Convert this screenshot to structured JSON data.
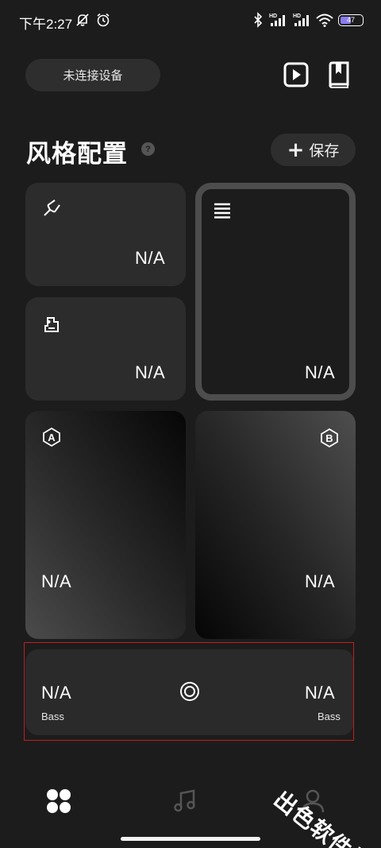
{
  "status_bar": {
    "time": "下午2:27",
    "battery_level": "47",
    "battery_color": "#8a7cf0",
    "icons": [
      "mute-notification-icon",
      "alarm-icon",
      "bluetooth-icon",
      "hd-signal-icon",
      "hd-signal-icon",
      "wifi-icon",
      "battery-icon"
    ]
  },
  "header": {
    "device_status": "未连接设备",
    "play_icon": "play-icon",
    "book_icon": "bookmark-icon"
  },
  "page": {
    "title": "风格配置",
    "help_icon": "help-icon",
    "save_label": "保存"
  },
  "cards": {
    "tuning": {
      "icon": "tuning-fork-icon",
      "value": "N/A"
    },
    "eq": {
      "icon": "equalizer-icon",
      "value": "N/A"
    },
    "list": {
      "icon": "list-icon",
      "value": "N/A"
    },
    "preset_a": {
      "icon": "badge-a-icon",
      "value": "N/A"
    },
    "preset_b": {
      "icon": "badge-b-icon",
      "value": "N/A"
    },
    "bass": {
      "left_value": "N/A",
      "left_label": "Bass",
      "right_value": "N/A",
      "right_label": "Bass",
      "center_icon": "target-icon"
    }
  },
  "bottom_nav": {
    "items": [
      {
        "icon": "grid-icon",
        "active": true
      },
      {
        "icon": "music-note-icon",
        "active": false
      },
      {
        "icon": "profile-icon",
        "active": false
      }
    ]
  },
  "highlight_color": "#c0201f",
  "watermark": "出色软件站"
}
